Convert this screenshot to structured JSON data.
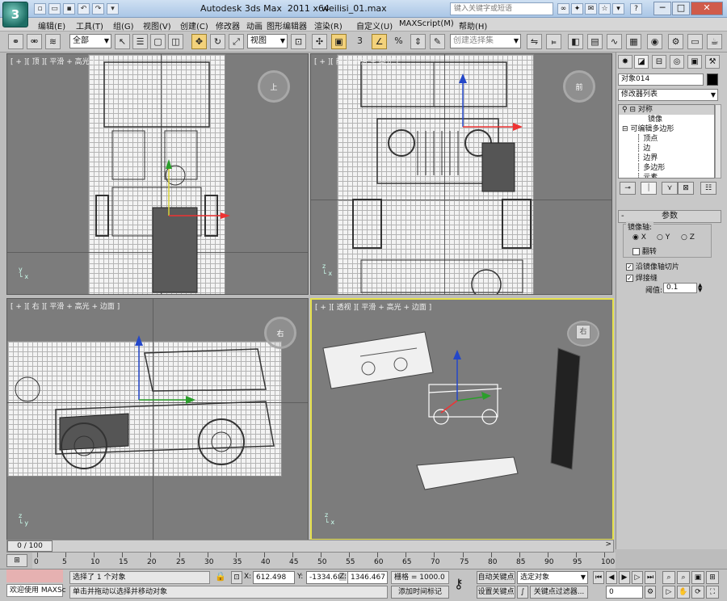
{
  "window": {
    "app_title": "Autodesk 3ds Max  2011 x64",
    "file_name": "weilisi_01.max",
    "search_placeholder": "键入关键字或短语",
    "logo": "3ds-max-logo",
    "minimize": "─",
    "maximize": "□",
    "close": "✕",
    "help": "?"
  },
  "menu": {
    "items": [
      "编辑(E)",
      "工具(T)",
      "组(G)",
      "视图(V)",
      "创建(C)",
      "修改器",
      "动画",
      "图形编辑器",
      "渲染(R)",
      "自定义(U)",
      "MAXScript(M)",
      "帮助(H)"
    ]
  },
  "toolbar": {
    "selection_filter": "全部",
    "ref_coord": "视图",
    "named_selection_placeholder": "创建选择集",
    "snap_label": "3",
    "percent_label": "%"
  },
  "viewports": {
    "top_label": "[ + ][ 顶 ][ 平滑 + 高光 ]",
    "front_label": "[ + ][ 前 ][ 平滑 + 高光 ]",
    "left_label": "[ + ][ 右 ][ 平滑 + 高光 + 边面 ]",
    "persp_label": "[ + ][ 透视 ][ 平滑 + 高光 + 边面 ]",
    "top_cube": "上",
    "front_cube": "前",
    "left_cube": "右",
    "persp_cube": "右"
  },
  "command_panel": {
    "object_name": "对象014",
    "modifier_list": "修改器列表",
    "stack": [
      {
        "label": "对称",
        "indent": 0,
        "selected": true
      },
      {
        "label": "镜像",
        "indent": 2,
        "selected": false
      },
      {
        "label": "可编辑多边形",
        "indent": 0,
        "selected": false
      },
      {
        "label": "顶点",
        "indent": 1,
        "selected": false
      },
      {
        "label": "边",
        "indent": 1,
        "selected": false
      },
      {
        "label": "边界",
        "indent": 1,
        "selected": false
      },
      {
        "label": "多边形",
        "indent": 1,
        "selected": false
      },
      {
        "label": "元素",
        "indent": 1,
        "selected": false
      }
    ],
    "rollout_title": "参数",
    "mirror_axis_label": "镜像轴:",
    "axis_x": "X",
    "axis_y": "Y",
    "axis_z": "Z",
    "flip_label": "翻转",
    "slice_label": "沿镜像轴切片",
    "weld_label": "焊接缝",
    "threshold_label": "阈值:",
    "threshold_value": "0.1"
  },
  "timeline": {
    "frame_display": "0 / 100",
    "ticks": [
      "0",
      "5",
      "10",
      "15",
      "20",
      "25",
      "30",
      "35",
      "40",
      "45",
      "50",
      "55",
      "60",
      "65",
      "70",
      "75",
      "80",
      "85",
      "90",
      "95",
      "100"
    ]
  },
  "status": {
    "welcome": "欢迎使用 MAXSc",
    "selection_info": "选择了 1 个对象",
    "prompt": "单击并拖动以选择并移动对象",
    "x_label": "X:",
    "x_value": "612.498",
    "y_label": "Y:",
    "y_value": "-1334.682",
    "z_label": "Z:",
    "z_value": "1346.467",
    "grid": "栅格 = 1000.0",
    "add_time_tag": "添加时间标记",
    "auto_key": "自动关键点",
    "set_key": "设置关键点",
    "key_mode_select": "选定对象",
    "key_filters": "关键点过滤器...",
    "frame_value": "0"
  },
  "colors": {
    "active_viewport_border": "#e6e14c",
    "viewport_bg": "#7c7c7c",
    "selection_orange": "#f3d27b"
  }
}
